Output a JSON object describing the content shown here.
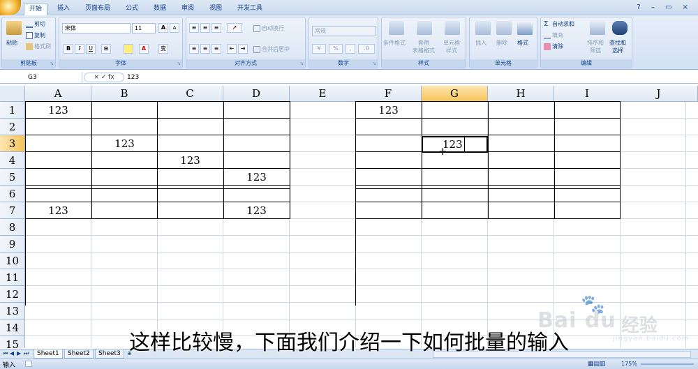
{
  "menu": {
    "tabs": [
      {
        "label": "开始",
        "active": true
      },
      {
        "label": "插入",
        "active": false
      },
      {
        "label": "页面布局",
        "active": false
      },
      {
        "label": "公式",
        "active": false
      },
      {
        "label": "数据",
        "active": false
      },
      {
        "label": "审阅",
        "active": false
      },
      {
        "label": "视图",
        "active": false
      },
      {
        "label": "开发工具",
        "active": false
      }
    ],
    "help_glyphs": "? – ▭ ×"
  },
  "ribbon": {
    "clipboard": {
      "label": "剪贴板",
      "paste": "粘贴",
      "cut": "剪切",
      "copy": "复制",
      "format_painter": "格式刷"
    },
    "font": {
      "label": "字体",
      "font_name": "宋体",
      "font_size": "11",
      "grow": "A",
      "shrink": "A",
      "bold": "B",
      "italic": "I",
      "underline": "U",
      "font_color_glyph": "A",
      "phonetic": "变"
    },
    "alignment": {
      "label": "对齐方式",
      "wrap": "自动换行",
      "merge": "合并后居中"
    },
    "number": {
      "label": "数字",
      "format": "常规",
      "percent": "%"
    },
    "styles": {
      "label": "样式",
      "conditional": "条件格式",
      "table": "套用\n表格格式",
      "cell_styles": "单元格\n样式"
    },
    "cells": {
      "label": "单元格",
      "insert": "插入",
      "delete": "删除",
      "format": "格式"
    },
    "editing": {
      "label": "编辑",
      "autosum": "自动求和",
      "fill": "填充",
      "clear": "清除",
      "sort": "排序和\n筛选",
      "find": "查找和\n选择"
    }
  },
  "formula_bar": {
    "name_box": "G3",
    "icons": "× ✓ fx",
    "value": "123"
  },
  "grid": {
    "columns": [
      "A",
      "B",
      "C",
      "D",
      "E",
      "F",
      "G",
      "H",
      "I",
      "J"
    ],
    "rows": [
      "1",
      "2",
      "3",
      "4",
      "5",
      "6",
      "7",
      "8",
      "9",
      "10",
      "11",
      "12",
      "13",
      "14",
      "15"
    ],
    "selected_column": "G",
    "selected_row": "3",
    "cells": [
      {
        "ref": "A1",
        "value": "123"
      },
      {
        "ref": "B3",
        "value": "123"
      },
      {
        "ref": "C4",
        "value": "123"
      },
      {
        "ref": "D5",
        "value": "123"
      },
      {
        "ref": "A7",
        "value": "123"
      },
      {
        "ref": "D7",
        "value": "123"
      },
      {
        "ref": "F1",
        "value": "123"
      }
    ],
    "active_cell": {
      "ref": "G3",
      "value": "123"
    }
  },
  "sheets": {
    "tabs": [
      {
        "label": "Sheet1",
        "active": true
      },
      {
        "label": "Sheet2",
        "active": false
      },
      {
        "label": "Sheet3",
        "active": false
      }
    ]
  },
  "status": {
    "mode": "输入",
    "zoom": "175%"
  },
  "overlay": {
    "subtitle": "这样比较慢，下面我们介绍一下如何批量的输入",
    "watermark_brand": "Bai du",
    "watermark_brand2": "经验",
    "watermark_url": "jingyan.baidu.com"
  },
  "colors": {
    "selection_header": "#f7c35a",
    "ribbon_text": "#15428b",
    "gridline": "#d0d7e5"
  }
}
